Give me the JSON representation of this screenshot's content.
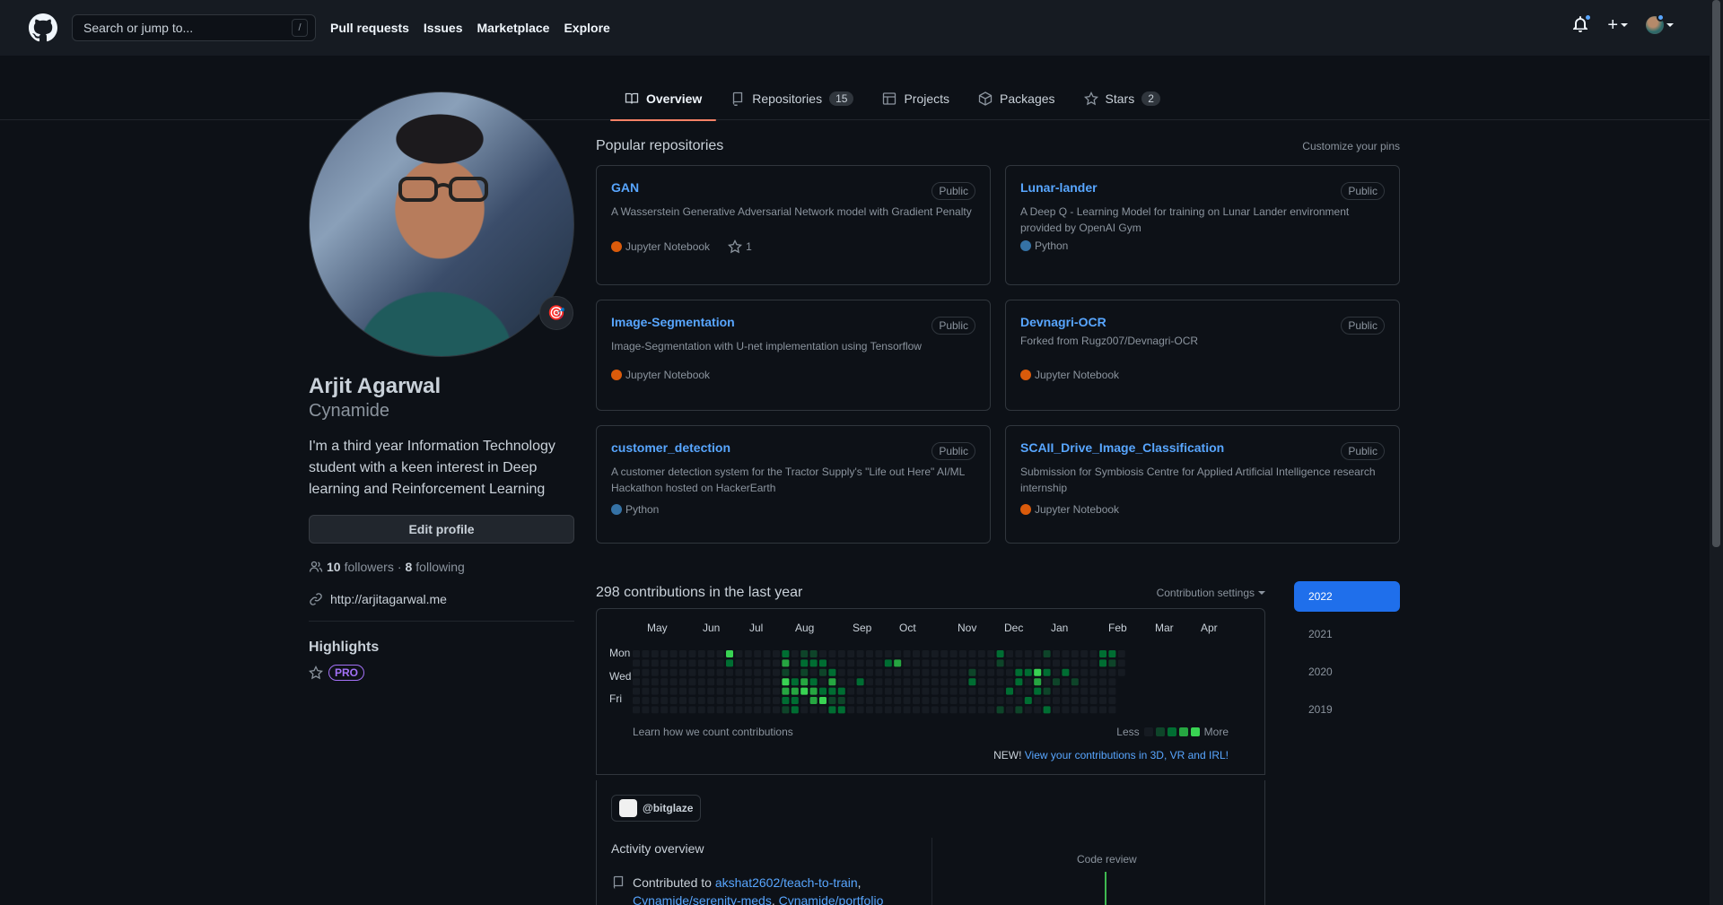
{
  "header": {
    "search_placeholder": "Search or jump to...",
    "slash_key": "/",
    "nav": [
      "Pull requests",
      "Issues",
      "Marketplace",
      "Explore"
    ],
    "plus_label": "+"
  },
  "tabs": [
    {
      "label": "Overview",
      "icon": "book-icon",
      "active": true
    },
    {
      "label": "Repositories",
      "icon": "repo-icon",
      "count": "15"
    },
    {
      "label": "Projects",
      "icon": "table-icon"
    },
    {
      "label": "Packages",
      "icon": "package-icon"
    },
    {
      "label": "Stars",
      "icon": "star-icon",
      "count": "2"
    }
  ],
  "profile": {
    "full_name": "Arjit Agarwal",
    "login": "Cynamide",
    "status_emoji": "🎯",
    "bio": "I'm a third year Information Technology student with a keen interest in Deep learning and Reinforcement Learning",
    "edit_button": "Edit profile",
    "followers_count": "10",
    "followers_label": "followers",
    "dot": "·",
    "following_count": "8",
    "following_label": "following",
    "website": "http://arjitagarwal.me",
    "highlights_title": "Highlights",
    "pro_badge": "PRO"
  },
  "pinned": {
    "title": "Popular repositories",
    "customize": "Customize your pins",
    "items": [
      {
        "name": "GAN",
        "visibility": "Public",
        "desc": "A Wasserstein Generative Adversarial Network model with Gradient Penalty",
        "lang": "Jupyter Notebook",
        "lang_color": "#DA5B0B",
        "stars": "1"
      },
      {
        "name": "Lunar-lander",
        "visibility": "Public",
        "desc": "A Deep Q - Learning Model for training on Lunar Lander environment provided by OpenAI Gym",
        "lang": "Python",
        "lang_color": "#3572A5"
      },
      {
        "name": "Image-Segmentation",
        "visibility": "Public",
        "desc": "Image-Segmentation with U-net implementation using Tensorflow",
        "lang": "Jupyter Notebook",
        "lang_color": "#DA5B0B"
      },
      {
        "name": "Devnagri-OCR",
        "visibility": "Public",
        "desc": "Forked from Rugz007/Devnagri-OCR",
        "lang": "Jupyter Notebook",
        "lang_color": "#DA5B0B"
      },
      {
        "name": "customer_detection",
        "visibility": "Public",
        "desc": "A customer detection system for the Tractor Supply's \"Life out Here\" AI/ML Hackathon hosted on HackerEarth",
        "lang": "Python",
        "lang_color": "#3572A5"
      },
      {
        "name": "SCAII_Drive_Image_Classification",
        "visibility": "Public",
        "desc": "Submission for Symbiosis Centre for Applied Artificial Intelligence research internship",
        "lang": "Jupyter Notebook",
        "lang_color": "#DA5B0B"
      }
    ]
  },
  "contributions": {
    "title": "298 contributions in the last year",
    "settings": "Contribution settings",
    "months": [
      "May",
      "Jun",
      "Jul",
      "Aug",
      "Sep",
      "Oct",
      "Nov",
      "Dec",
      "Jan",
      "Feb",
      "Mar",
      "Apr"
    ],
    "days": [
      "Mon",
      "Wed",
      "Fri"
    ],
    "learn": "Learn how we count contributions",
    "less": "Less",
    "more": "More",
    "new_tag": "NEW!",
    "new_link": "View your contributions in 3D, VR and IRL!",
    "level_colors": [
      "#161b22",
      "#0e4429",
      "#006d32",
      "#26a641",
      "#39d353"
    ],
    "years": [
      "2022",
      "2021",
      "2020",
      "2019"
    ],
    "active_year": "2022"
  },
  "activity": {
    "org": "@bitglaze",
    "title": "Activity overview",
    "contributed_prefix": "Contributed to",
    "repo1": "akshat2602/teach-to-train",
    "repo2": "Cynamide/serenity-meds",
    "repo3": "Cynamide/portfolio",
    "code_review": "Code review"
  }
}
